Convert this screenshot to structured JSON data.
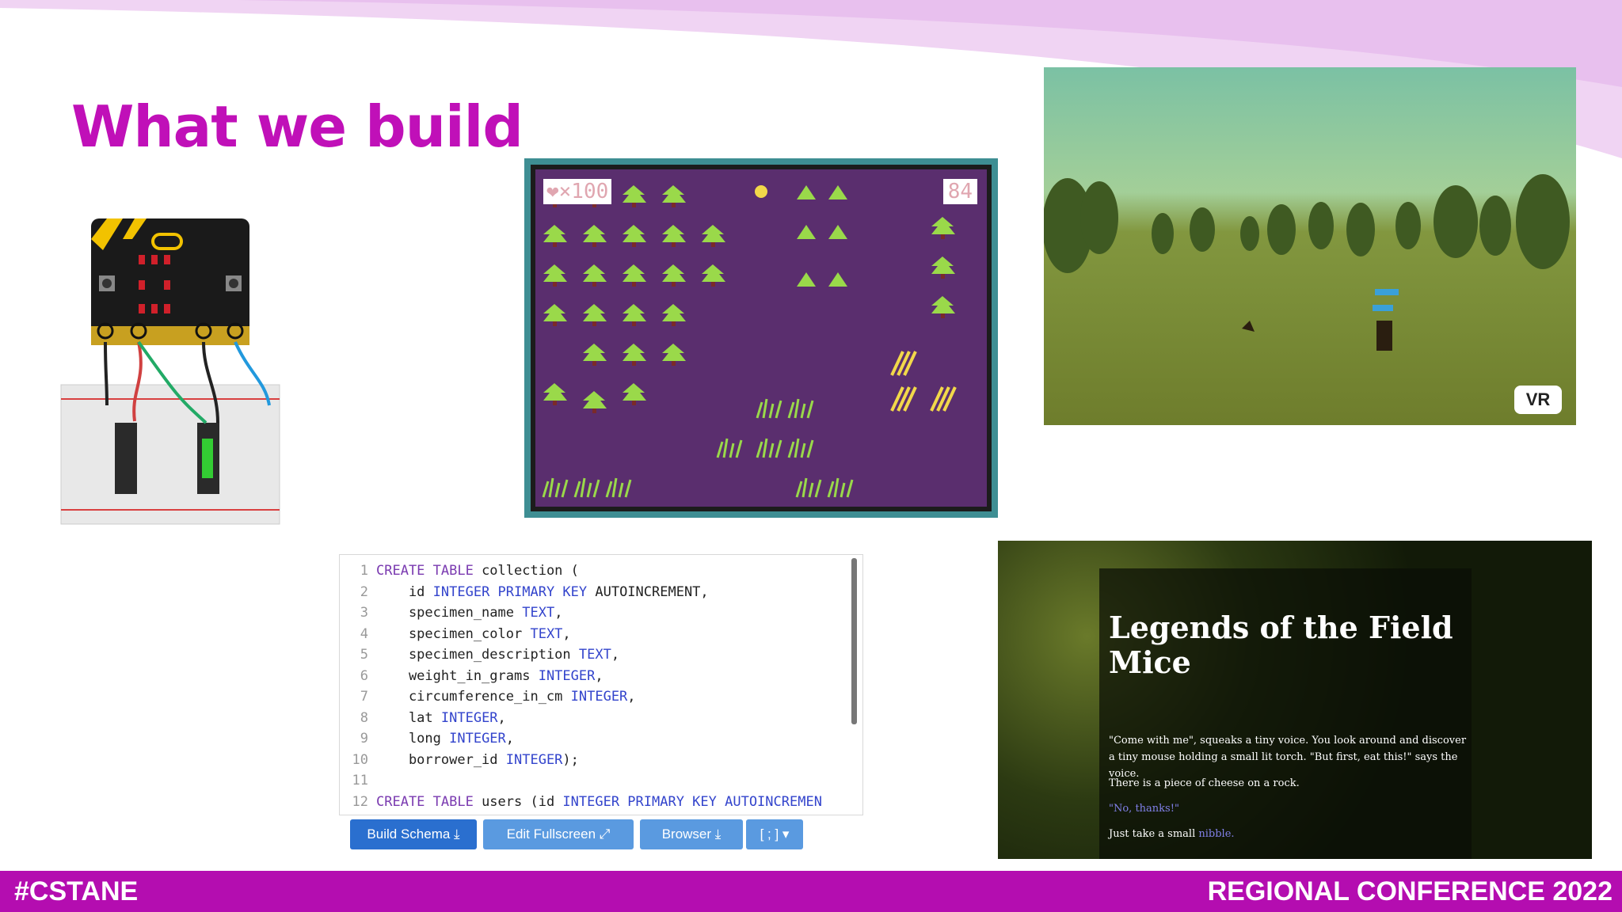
{
  "slide": {
    "title": "What we build",
    "footer_left": "#CSTANE",
    "footer_right": "REGIONAL CONFERENCE 2022"
  },
  "game": {
    "lives": "❤×100",
    "score": "84"
  },
  "vr": {
    "badge": "VR"
  },
  "editor": {
    "lines": [
      {
        "n": "1",
        "a": "CREATE TABLE",
        "b": " collection (",
        "c": ""
      },
      {
        "n": "2",
        "a": "    id ",
        "b": "INTEGER PRIMARY KEY",
        "c": " AUTOINCREMENT,"
      },
      {
        "n": "3",
        "a": "    specimen_name ",
        "b": "TEXT",
        "c": ","
      },
      {
        "n": "4",
        "a": "    specimen_color ",
        "b": "TEXT",
        "c": ","
      },
      {
        "n": "5",
        "a": "    specimen_description ",
        "b": "TEXT",
        "c": ","
      },
      {
        "n": "6",
        "a": "    weight_in_grams ",
        "b": "INTEGER",
        "c": ","
      },
      {
        "n": "7",
        "a": "    circumference_in_cm ",
        "b": "INTEGER",
        "c": ","
      },
      {
        "n": "8",
        "a": "    lat ",
        "b": "INTEGER",
        "c": ","
      },
      {
        "n": "9",
        "a": "    long ",
        "b": "INTEGER",
        "c": ","
      },
      {
        "n": "10",
        "a": "    borrower_id ",
        "b": "INTEGER",
        "c": ");"
      },
      {
        "n": "11",
        "a": "",
        "b": "",
        "c": ""
      },
      {
        "n": "12",
        "a": "CREATE TABLE",
        "b": " users (id ",
        "c": "INTEGER PRIMARY KEY AUTOINCREMEN"
      }
    ],
    "buttons": {
      "build": "Build Schema ⤓",
      "fullscreen": "Edit Fullscreen ⤢",
      "browser": "Browser ⤓",
      "delim": "[ ; ] ▾"
    }
  },
  "story": {
    "title": "Legends of the Field Mice",
    "p1": "\"Come with me\", squeaks a tiny voice. You look around and discover a tiny mouse holding a small lit torch. \"But first, eat this!\" says the voice.",
    "p2": "There is a piece of cheese on a rock.",
    "choice1": "\"No, thanks!\"",
    "p3_prefix": "Just take a small ",
    "p3_link": "nibble."
  }
}
